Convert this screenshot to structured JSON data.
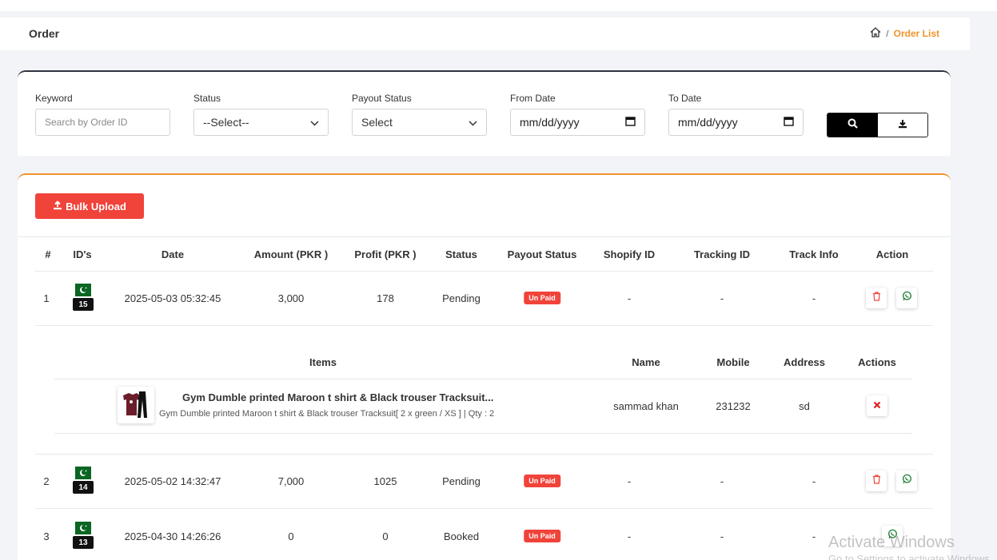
{
  "header": {
    "title": "Order",
    "breadcrumb_sep": "/",
    "breadcrumb_active": "Order List"
  },
  "filters": {
    "keyword_label": "Keyword",
    "keyword_placeholder": "Search by Order ID",
    "status_label": "Status",
    "status_value": "--Select--",
    "payout_label": "Payout Status",
    "payout_value": "Select",
    "from_label": "From Date",
    "from_value": "mm/dd/yyyy",
    "to_label": "To Date",
    "to_value": "mm/dd/yyyy"
  },
  "bulk_upload_label": "Bulk Upload",
  "table": {
    "headers": {
      "num": "#",
      "ids": "ID's",
      "date": "Date",
      "amount": "Amount (PKR )",
      "profit": "Profit (PKR )",
      "status": "Status",
      "payout": "Payout Status",
      "shopify": "Shopify ID",
      "tracking": "Tracking ID",
      "trackinfo": "Track Info",
      "action": "Action"
    },
    "rows": [
      {
        "num": "1",
        "id": "15",
        "date": "2025-05-03 05:32:45",
        "amount": "3,000",
        "profit": "178",
        "status": "Pending",
        "payout": "Un Paid",
        "shopify": "-",
        "tracking": "-",
        "trackinfo": "-"
      },
      {
        "num": "2",
        "id": "14",
        "date": "2025-05-02 14:32:47",
        "amount": "7,000",
        "profit": "1025",
        "status": "Pending",
        "payout": "Un Paid",
        "shopify": "-",
        "tracking": "-",
        "trackinfo": "-"
      },
      {
        "num": "3",
        "id": "13",
        "date": "2025-04-30 14:26:26",
        "amount": "0",
        "profit": "0",
        "status": "Booked",
        "payout": "Un Paid",
        "shopify": "-",
        "tracking": "-",
        "trackinfo": "-"
      }
    ]
  },
  "detail": {
    "headers": {
      "items": "Items",
      "name": "Name",
      "mobile": "Mobile",
      "address": "Address",
      "actions": "Actions"
    },
    "item_title": "Gym Dumble printed Maroon t shirt & Black trouser Tracksuit...",
    "item_desc": "Gym Dumble printed Maroon t shirt & Black trouser Tracksuit[ 2 x green / XS ] | Qty : 2",
    "name": "sammad khan",
    "mobile": "231232",
    "address": "sd"
  },
  "watermark": {
    "line1": "Activate Windows",
    "line2": "Go to Settings to activate Windows."
  },
  "colors": {
    "accent": "#f0932b",
    "danger": "#f0433a",
    "flag": "#0b6623"
  },
  "icons": [
    "home-icon",
    "search-icon",
    "download-icon",
    "upload-icon",
    "trash-icon",
    "whatsapp-icon",
    "close-icon",
    "chevron-down-icon",
    "calendar-icon",
    "flag-icon"
  ]
}
